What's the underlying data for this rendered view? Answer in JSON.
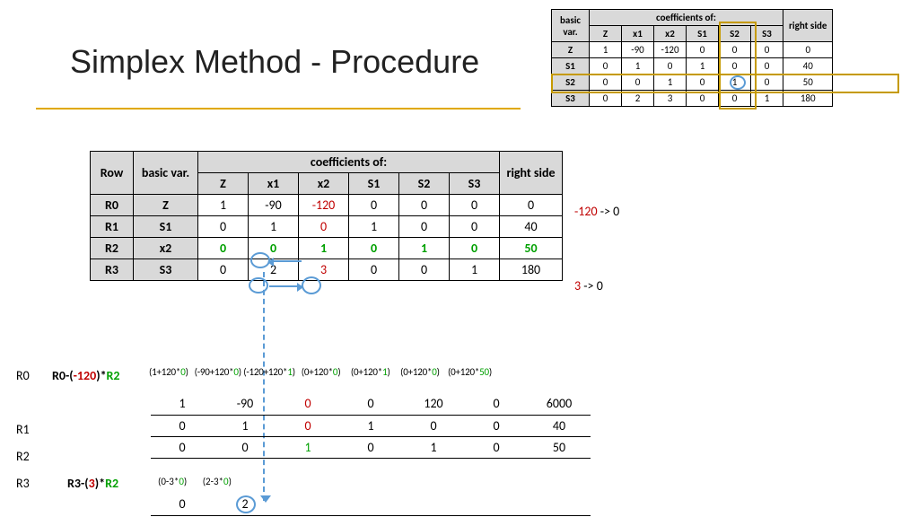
{
  "title": "Simplex Method - Procedure",
  "mini": {
    "headers": {
      "basic_var": "basic var.",
      "coeff": "coefficients of:",
      "Z": "Z",
      "x1": "x1",
      "x2": "x2",
      "S1": "S1",
      "S2": "S2",
      "S3": "S3",
      "right": "right side"
    },
    "rows": [
      {
        "bv": "Z",
        "Z": "1",
        "x1": "-90",
        "x2": "-120",
        "S1": "0",
        "S2": "0",
        "S3": "0",
        "rs": "0"
      },
      {
        "bv": "S1",
        "Z": "0",
        "x1": "1",
        "x2": "0",
        "S1": "1",
        "S2": "0",
        "S3": "0",
        "rs": "40"
      },
      {
        "bv": "S2",
        "Z": "0",
        "x1": "0",
        "x2": "1",
        "S1": "0",
        "S2": "1",
        "S3": "0",
        "rs": "50"
      },
      {
        "bv": "S3",
        "Z": "0",
        "x1": "2",
        "x2": "3",
        "S1": "0",
        "S2": "0",
        "S3": "1",
        "rs": "180"
      }
    ]
  },
  "main": {
    "headers": {
      "row": "Row",
      "basic_var": "basic var.",
      "coeff": "coefficients of:",
      "Z": "Z",
      "x1": "x1",
      "x2": "x2",
      "S1": "S1",
      "S2": "S2",
      "S3": "S3",
      "right": "right side"
    },
    "rows": [
      {
        "r": "R0",
        "bv": "Z",
        "Z": "1",
        "x1": "-90",
        "x2": "-120",
        "S1": "0",
        "S2": "0",
        "S3": "0",
        "rs": "0"
      },
      {
        "r": "R1",
        "bv": "S1",
        "Z": "0",
        "x1": "1",
        "x2": "0",
        "S1": "1",
        "S2": "0",
        "S3": "0",
        "rs": "40"
      },
      {
        "r": "R2",
        "bv": "x2",
        "Z": "0",
        "x1": "0",
        "x2": "1",
        "S1": "0",
        "S2": "1",
        "S3": "0",
        "rs": "50"
      },
      {
        "r": "R3",
        "bv": "S3",
        "Z": "0",
        "x1": "2",
        "x2": "3",
        "S1": "0",
        "S2": "0",
        "S3": "1",
        "rs": "180"
      }
    ]
  },
  "notes": {
    "n1a": "-120",
    "n1b": " -> 0",
    "n2a": "3",
    "n2b": " -> 0"
  },
  "ops": {
    "r0": {
      "label": "R0",
      "rule_pre": "R0-(",
      "rule_mid": "-120",
      "rule_post": ")*",
      "rule_r2": "R2",
      "f": [
        "(1+120*",
        "0",
        ")",
        "(-90+120*",
        "0",
        ")",
        "(-120+120*",
        "1",
        ")",
        "(0+120*",
        "0",
        ")",
        "(0+120*",
        "1",
        ")",
        "(0+120*",
        "0",
        ")",
        "(0+120*",
        "50",
        ")"
      ],
      "vals": [
        "1",
        "-90",
        "0",
        "0",
        "120",
        "0",
        "6000"
      ]
    },
    "r1": {
      "label": "R1",
      "vals": [
        "0",
        "1",
        "0",
        "1",
        "0",
        "0",
        "40"
      ]
    },
    "r2": {
      "label": "R2",
      "vals": [
        "0",
        "0",
        "1",
        "0",
        "1",
        "0",
        "50"
      ]
    },
    "r3": {
      "label": "R3",
      "rule_pre": "R3-(",
      "rule_mid": "3",
      "rule_post": ")*",
      "rule_r2": "R2",
      "f": [
        "(0-3*",
        "0",
        ")",
        "(2-3*",
        "0",
        ")"
      ],
      "vals": [
        "0",
        "2"
      ]
    }
  }
}
